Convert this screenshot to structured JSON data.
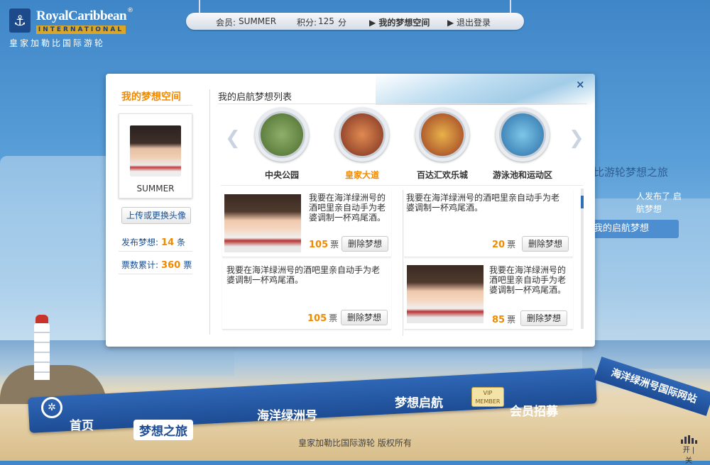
{
  "logo": {
    "brand": "RoyalCaribbean",
    "sub": "INTERNATIONAL",
    "reg": "®",
    "cn": "皇家加勒比国际游轮"
  },
  "topbar": {
    "member_label": "会员:",
    "member_name": "SUMMER",
    "points_label": "积分:",
    "points_value": "125",
    "points_unit": "分",
    "dream_space": "▶ 我的梦想空间",
    "logout": "▶ 退出登录"
  },
  "background": {
    "headline": "比游轮梦想之旅",
    "published": "人发布了 启航梦想",
    "my_list_btn": "我的启航梦想"
  },
  "modal": {
    "close": "×",
    "left_title": "我的梦想空间",
    "username": "SUMMER",
    "upload_btn": "上传或更换头像",
    "stats": {
      "published_label": "发布梦想:",
      "published_value": "14",
      "published_unit": "条",
      "votes_label": "票数累计:",
      "votes_value": "360",
      "votes_unit": "票"
    },
    "right_title": "我的启航梦想列表",
    "prev": "❮",
    "next": "❯",
    "locations": [
      {
        "label": "中央公园",
        "active": false
      },
      {
        "label": "皇家大道",
        "active": true
      },
      {
        "label": "百达汇欢乐城",
        "active": false
      },
      {
        "label": "游泳池和运动区",
        "active": false
      }
    ],
    "cards": [
      {
        "text": "我要在海洋绿洲号的酒吧里亲自动手为老婆调制一杯鸡尾酒。",
        "votes": "105",
        "unit": "票",
        "delete": "删除梦想"
      },
      {
        "text": "我要在海洋绿洲号的酒吧里亲自动手为老婆调制一杯鸡尾酒。",
        "votes": "20",
        "unit": "票",
        "delete": "删除梦想"
      },
      {
        "text": "我要在海洋绿洲号的酒吧里亲自动手为老婆调制一杯鸡尾酒。",
        "votes": "105",
        "unit": "票",
        "delete": "删除梦想"
      },
      {
        "text": "我要在海洋绿洲号的酒吧里亲自动手为老婆调制一杯鸡尾酒。",
        "votes": "85",
        "unit": "票",
        "delete": "删除梦想"
      }
    ]
  },
  "nav": {
    "home": "首页",
    "dream_trip": "梦想之旅",
    "oasis": "海洋绿洲号",
    "dream_sail": "梦想启航",
    "vip": "VIP MEMBER",
    "member": "会员招募",
    "site": "海洋绿洲号国际网站"
  },
  "footer": {
    "copyright": "皇家加勒比国际游轮  版权所有",
    "sound": "开 | 关"
  }
}
